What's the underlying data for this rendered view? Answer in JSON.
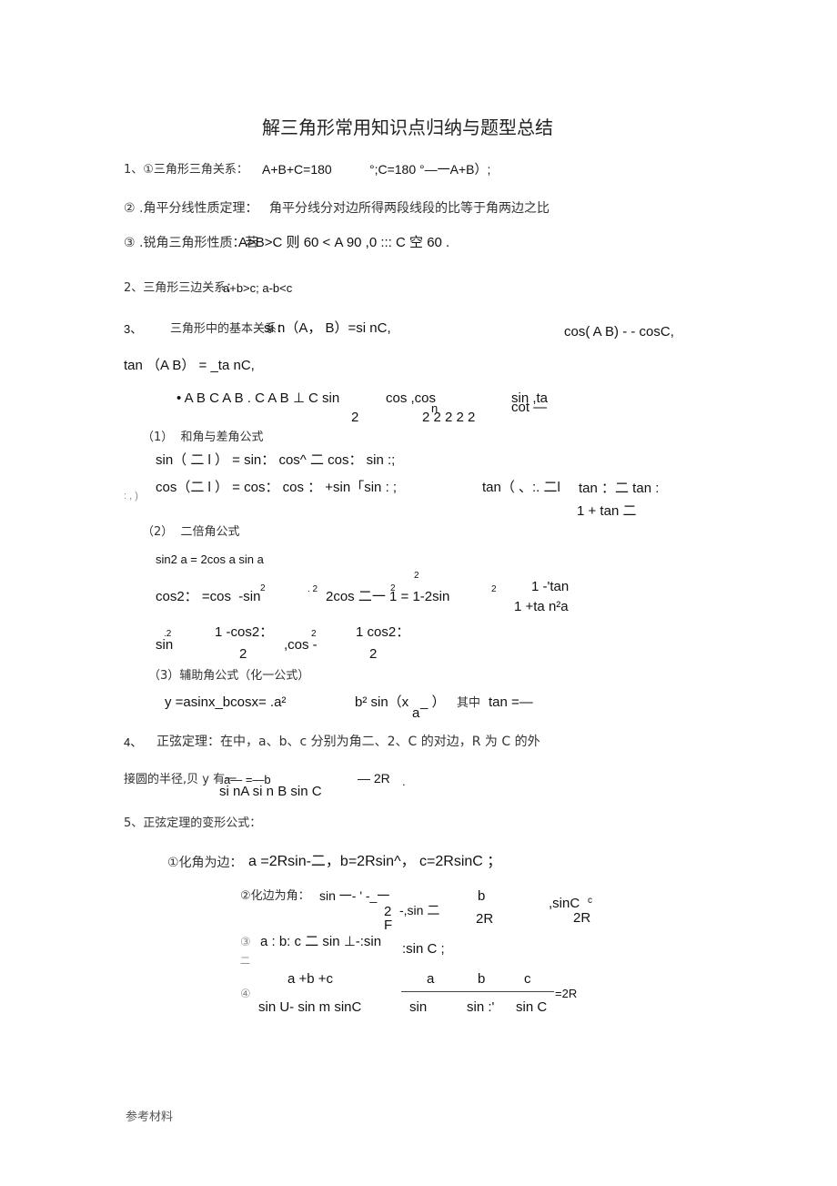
{
  "title": "解三角形常用知识点归纳与题型总结",
  "section1": {
    "line1_label": "1、①三角形三角关系：",
    "line1_formula_a": "A+B+C=180",
    "line1_formula_b": "°;C=180 °—一A+B）;",
    "line2_label": "② .角平分线性质定理：",
    "line2_text": "角平分线分对边所得两段线段的比等于角两边之比",
    "line3_label": "③ .锐角三角形性质：若",
    "line3_formula": "A>B>C 则 60 < A 90 ,0 ::: C 空 60 ."
  },
  "section2": {
    "label": "2、三角形三边关系：",
    "formula": "a+b>c; a-b<c"
  },
  "section3": {
    "num": "3、",
    "label": "三角形中的基本关系：",
    "formula_sin": "si n（A， B）=si nC,",
    "formula_cos": "cos( A B) - - cosC,",
    "formula_tan": "tan （A B） = _ta nC,",
    "half_angle_main": "• A B C A B . C A B ⊥ C sin",
    "half_angle_cos": "cos ,cos",
    "half_angle_n": "n",
    "half_angle_sin": "sin ,ta",
    "half_angle_cot": "cot —",
    "half_angle_den1": "2",
    "half_angle_den2": "2 2 2 2 2",
    "sub1_title": "（1）  和角与差角公式",
    "sub1_sin": "sin（ 二 l ） = sin： cos^ 二 cos： sin :;",
    "sub1_cos_prefix": ": , )",
    "sub1_cos": "cos（二 l ） = cos： cos ： +sin「sin : ;",
    "sub1_tan_a": "tan（ 、:. 二l",
    "sub1_tan_b": "tan ：二 tan :",
    "sub1_tan_den": "1 + tan 二",
    "sub2_title": "（2）  二倍角公式",
    "sub2_sin2": "sin2 a = 2cos a sin a",
    "sub2_cos2": "cos2： =cos  -sin",
    "sub2_cos2_sup1": "2",
    "sub2_cos2_sup2": ". 2",
    "sub2_cos2_b": "2cos 二一 1 = 1-2sin",
    "sub2_cos2_sup3": "2",
    "sub2_cos2_sup4": "2",
    "sub2_cos2_sup5": "2",
    "sub2_tan_num": "1 -'tan",
    "sub2_tan_den": "1 +ta n²a",
    "sub2_sinsq": "sin",
    "sub2_sinsq_sup": ".2",
    "sub2_sinsq_num": "1 -cos2：",
    "sub2_sinsq_den": "2",
    "sub2_cossq": ",cos -",
    "sub2_cossq_sup": "2",
    "sub2_cossq_num": "1 cos2：",
    "sub2_cossq_den": "2",
    "sub3_title": "（3）辅助角公式（化一公式）",
    "sub3_formula": "y =asinx_bcosx= .a²",
    "sub3_formula_b": "b² sin（x",
    "sub3_formula_b2": "_ ）",
    "sub3_sub_a": "a",
    "sub3_where": "其中",
    "sub3_tan": "tan =—"
  },
  "section4": {
    "num": "4、",
    "text1": "正弦定理：在中，a、b、c 分别为角二、2、C 的对边，R 为 C 的外",
    "text2_prefix": "接圆的半径,贝 y 有一",
    "frac_num": "a— =—b",
    "frac_den": "si nA si n B sin C",
    "frac_tail": "— 2R",
    "frac_end": "."
  },
  "section5": {
    "title": "5、正弦定理的变形公式：",
    "item1_label": "①化角为边：",
    "item1_formula": "a =2Rsin-二，b=2Rsin^， c=2RsinC ；",
    "item2_label": "②化边为角：",
    "item2_formula_a": "sin 一- ' -_一",
    "item2_den_a": "2",
    "item2_den_a2": "F",
    "item2_formula_b": "-,sin 二",
    "item2_num_b": "b",
    "item2_den_b": "2R",
    "item2_formula_c": ",sinC",
    "item2_num_c": "c",
    "item2_den_c": "2R",
    "item3_label": "③",
    "item3_formula": "a : b: c 二 sin ⊥-:sin",
    "item3_tail": ":sin C ;",
    "item3_under": "二",
    "item4_label": "④",
    "item4_num": "a +b +c",
    "item4_den": "sin U- sin m sinC",
    "item4_num_a": "a",
    "item4_num_b": "b",
    "item4_num_c": "c",
    "item4_den_a": "sin",
    "item4_den_b": "sin :'",
    "item4_den_c": "sin C",
    "item4_eq": "=2R"
  },
  "footer": "参考材料"
}
